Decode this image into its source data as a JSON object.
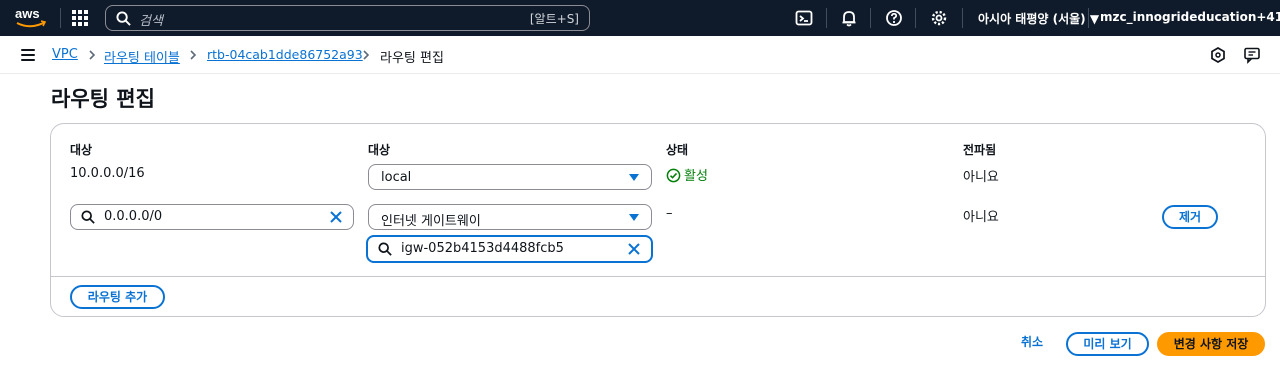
{
  "topnav": {
    "logo_text": "aws",
    "search_placeholder": "검색",
    "search_shortcut": "[알트+S]",
    "region": "아시아 태평양 (서울) ▼",
    "account": "mzc_innogrideducation+41 ▼",
    "icons": [
      "grid-icon",
      "search-icon",
      "terminal-icon",
      "bell-icon",
      "help-icon",
      "gear-icon"
    ]
  },
  "breadcrumb": {
    "items": [
      "VPC",
      "라우팅 테이블",
      "rtb-04cab1dde86752a93",
      "라우팅 편집"
    ]
  },
  "page": {
    "title": "라우팅 편집"
  },
  "routes": {
    "headers": {
      "destination": "대상",
      "target": "대상",
      "status": "상태",
      "propagated": "전파됨"
    },
    "rows": [
      {
        "destination": "10.0.0.0/16",
        "target": "local",
        "status": "활성",
        "propagated": "아니요"
      },
      {
        "destination": "0.0.0.0/0",
        "target": "인터넷 게이트웨이",
        "target_id": "igw-052b4153d4488fcb5",
        "status": "–",
        "propagated": "아니요",
        "remove_label": "제거"
      }
    ],
    "add_route_label": "라우팅 추가"
  },
  "footer": {
    "cancel_label": "취소",
    "preview_label": "미리 보기",
    "save_label": "변경 사항 저장"
  },
  "colors": {
    "accent": "#0972d3",
    "primary": "#ff9900",
    "success": "#037f0c",
    "nav_bg": "#0f1b2a"
  }
}
